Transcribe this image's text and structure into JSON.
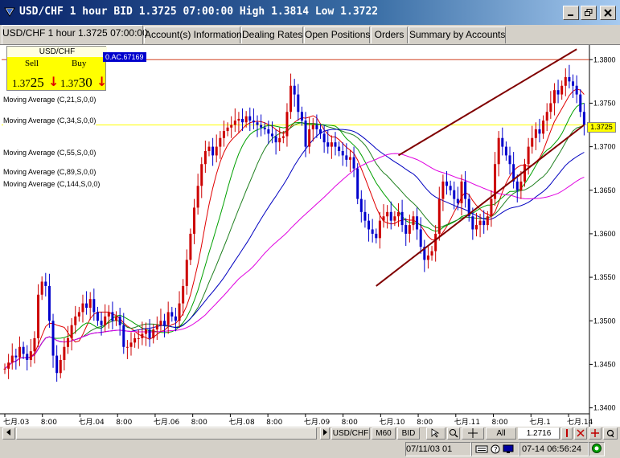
{
  "window": {
    "title": "USD/CHF  1 hour BID  1.3725  07:00:00  High  1.3814  Low  1.3722"
  },
  "tabs": [
    {
      "label": "USD/CHF 1 hour 1.3725 07:00:00",
      "active": true
    },
    {
      "label": "Account(s) Information"
    },
    {
      "label": "Dealing Rates"
    },
    {
      "label": "Open Positions"
    },
    {
      "label": "Orders"
    },
    {
      "label": "Summary by Accounts"
    }
  ],
  "quote": {
    "symbol": "USD/CHF",
    "sell_label": "Sell",
    "buy_label": "Buy",
    "sell_price_prefix": "1.37",
    "sell_price_big": "25",
    "buy_price_prefix": "1.37",
    "buy_price_big": "30",
    "arrow_glyph": "↓"
  },
  "order_tag": "0.AC.67169",
  "current_price_tag": "1.3725",
  "indicators": [
    "Moving Average (C,21,S,0,0)",
    "Moving Average (C,34,S,0,0)",
    "Moving Average (C,55,S,0,0)",
    "Moving Average (C,89,S,0,0)",
    "Moving Average (C,144,S,0,0)"
  ],
  "chart_data": {
    "type": "candlestick",
    "y_tick_labels": [
      "1.3800",
      "1.3750",
      "1.3700",
      "1.3650",
      "1.3600",
      "1.3550",
      "1.3500",
      "1.3450",
      "1.3400"
    ],
    "ylim": [
      1.3395,
      1.3815
    ],
    "x_tick_labels": [
      "七月.03",
      "8:00",
      "七月.04",
      "8:00",
      "七月.06",
      "8:00",
      "七月.08",
      "8:00",
      "七月.09",
      "8:00",
      "七月.10",
      "8:00",
      "七月.11",
      "8:00",
      "七月.1",
      "七月.14"
    ],
    "grid": true,
    "current_price": 1.3725,
    "horizontal_line_red": 1.38,
    "closes": [
      1.3445,
      1.3452,
      1.346,
      1.3458,
      1.347,
      1.3462,
      1.3455,
      1.3465,
      1.348,
      1.353,
      1.3545,
      1.354,
      1.35,
      1.346,
      1.344,
      1.3455,
      1.347,
      1.348,
      1.3495,
      1.3505,
      1.351,
      1.352,
      1.3515,
      1.3525,
      1.351,
      1.35,
      1.3495,
      1.3505,
      1.351,
      1.35,
      1.3505,
      1.3495,
      1.347,
      1.347,
      1.3475,
      1.348,
      1.348,
      1.3485,
      1.349,
      1.348,
      1.349,
      1.3495,
      1.35,
      1.3495,
      1.351,
      1.3505,
      1.35,
      1.352,
      1.354,
      1.357,
      1.36,
      1.363,
      1.3655,
      1.368,
      1.3695,
      1.37,
      1.369,
      1.37,
      1.371,
      1.3718,
      1.3722,
      1.3725,
      1.373,
      1.3732,
      1.3728,
      1.3735,
      1.373,
      1.3728,
      1.3725,
      1.3722,
      1.372,
      1.3715,
      1.3712,
      1.3705,
      1.371,
      1.3712,
      1.374,
      1.377,
      1.376,
      1.374,
      1.373,
      1.37,
      1.372,
      1.3725,
      1.372,
      1.3715,
      1.3705,
      1.37,
      1.3705,
      1.37,
      1.3695,
      1.369,
      1.3685,
      1.3688,
      1.3675,
      1.364,
      1.3625,
      1.3615,
      1.3605,
      1.36,
      1.3595,
      1.3615,
      1.362,
      1.3625,
      1.3615,
      1.362,
      1.3625,
      1.361,
      1.36,
      1.361,
      1.362,
      1.3605,
      1.3585,
      1.357,
      1.3575,
      1.358,
      1.36,
      1.364,
      1.366,
      1.3655,
      1.365,
      1.364,
      1.3635,
      1.366,
      1.364,
      1.362,
      1.3605,
      1.361,
      1.3615,
      1.361,
      1.362,
      1.364,
      1.368,
      1.371,
      1.37,
      1.369,
      1.368,
      1.366,
      1.365,
      1.366,
      1.368,
      1.37,
      1.371,
      1.372,
      1.3715,
      1.373,
      1.374,
      1.375,
      1.3765,
      1.376,
      1.377,
      1.378,
      1.3775,
      1.377,
      1.376,
      1.374,
      1.3725
    ],
    "ma_series": [
      {
        "name": "MA21",
        "color": "#e00000"
      },
      {
        "name": "MA34",
        "color": "#00a000"
      },
      {
        "name": "MA55",
        "color": "#208020"
      },
      {
        "name": "MA89",
        "color": "#0000c0"
      },
      {
        "name": "MA144",
        "color": "#e000e0"
      }
    ]
  },
  "toolbar": {
    "symbol_button": "USD/CHF",
    "period_button": "M60",
    "price_button": "BID",
    "all_button": "All",
    "value_field": "1.2716"
  },
  "status": {
    "left_text": "07/11/03  01",
    "right_text": "07-14  06:56:24"
  },
  "colors": {
    "bull": "#cc0000",
    "bear": "#0000cc",
    "trendline": "#800000",
    "current_price_line": "#ffff00"
  }
}
